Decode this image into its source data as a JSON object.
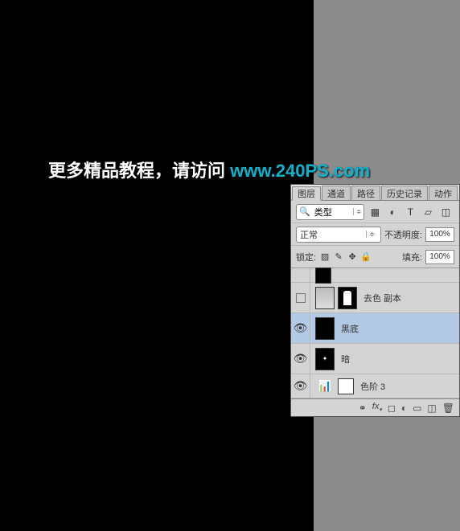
{
  "watermark": {
    "text": "更多精品教程，请访问 ",
    "link": "www.240PS.com"
  },
  "panel": {
    "tabs": [
      "图层",
      "通道",
      "路径",
      "历史记录",
      "动作"
    ],
    "activeTab": 0,
    "filterLabel": "类型",
    "blendMode": "正常",
    "opacityLabel": "不透明度:",
    "opacityValue": "100%",
    "lockLabel": "锁定:",
    "fillLabel": "填充:",
    "fillValue": "100%",
    "layers": [
      {
        "name": "去色 副本",
        "visible": false,
        "thumbs": [
          "gray",
          "mask"
        ]
      },
      {
        "name": "黑底",
        "visible": true,
        "selected": true,
        "thumbs": [
          "black"
        ]
      },
      {
        "name": "暗",
        "visible": true,
        "thumbs": [
          "dark"
        ]
      },
      {
        "name": "色阶 3",
        "visible": true,
        "thumbs": [
          "levels",
          "white"
        ]
      }
    ],
    "bottomIcons": [
      "link",
      "fx",
      "mask",
      "adj",
      "group",
      "new",
      "trash"
    ]
  }
}
